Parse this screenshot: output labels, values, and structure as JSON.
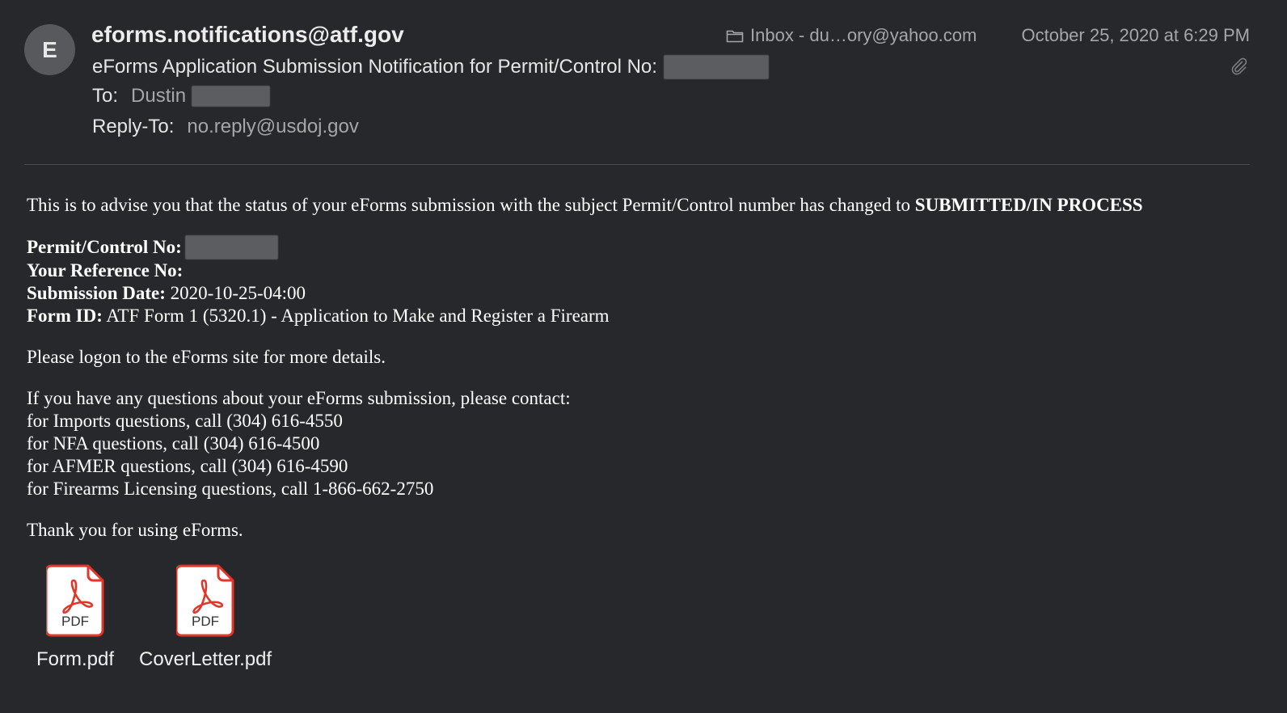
{
  "header": {
    "avatar_initial": "E",
    "from": "eforms.notifications@atf.gov",
    "subject": "eForms Application Submission Notification for Permit/Control No:",
    "to_label": "To:",
    "to_value": "Dustin",
    "reply_to_label": "Reply-To:",
    "reply_to_value": "no.reply@usdoj.gov",
    "mailbox": "Inbox - du…ory@yahoo.com",
    "date": "October 25, 2020 at 6:29 PM"
  },
  "body": {
    "intro": "This is to advise you that the status of your eForms submission with the subject Permit/Control number has changed to ",
    "status": "SUBMITTED/IN PROCESS",
    "permit_label": "Permit/Control No:",
    "reference_label": "Your Reference No:",
    "submission_date_label": "Submission Date:",
    "submission_date_value": "2020-10-25-04:00",
    "form_id_label": "Form ID:",
    "form_id_value": "ATF Form 1 (5320.1) - Application to Make and Register a Firearm",
    "logon": "Please logon to the eForms site for more details.",
    "contact_intro": "If you have any questions about your eForms submission, please contact:",
    "contacts": [
      "for Imports questions, call (304) 616-4550",
      "for NFA questions, call (304) 616-4500",
      "for AFMER questions, call (304) 616-4590",
      "for Firearms Licensing questions, call 1-866-662-2750"
    ],
    "thanks": "Thank you for using eForms."
  },
  "attachments": [
    {
      "name": "Form.pdf",
      "badge": "PDF",
      "icon": "pdf-file-icon"
    },
    {
      "name": "CoverLetter.pdf",
      "badge": "PDF",
      "icon": "pdf-file-icon"
    }
  ],
  "colors": {
    "background": "#27282b",
    "secondary_text": "#a6a6a8",
    "pdf_red": "#e0372b"
  }
}
